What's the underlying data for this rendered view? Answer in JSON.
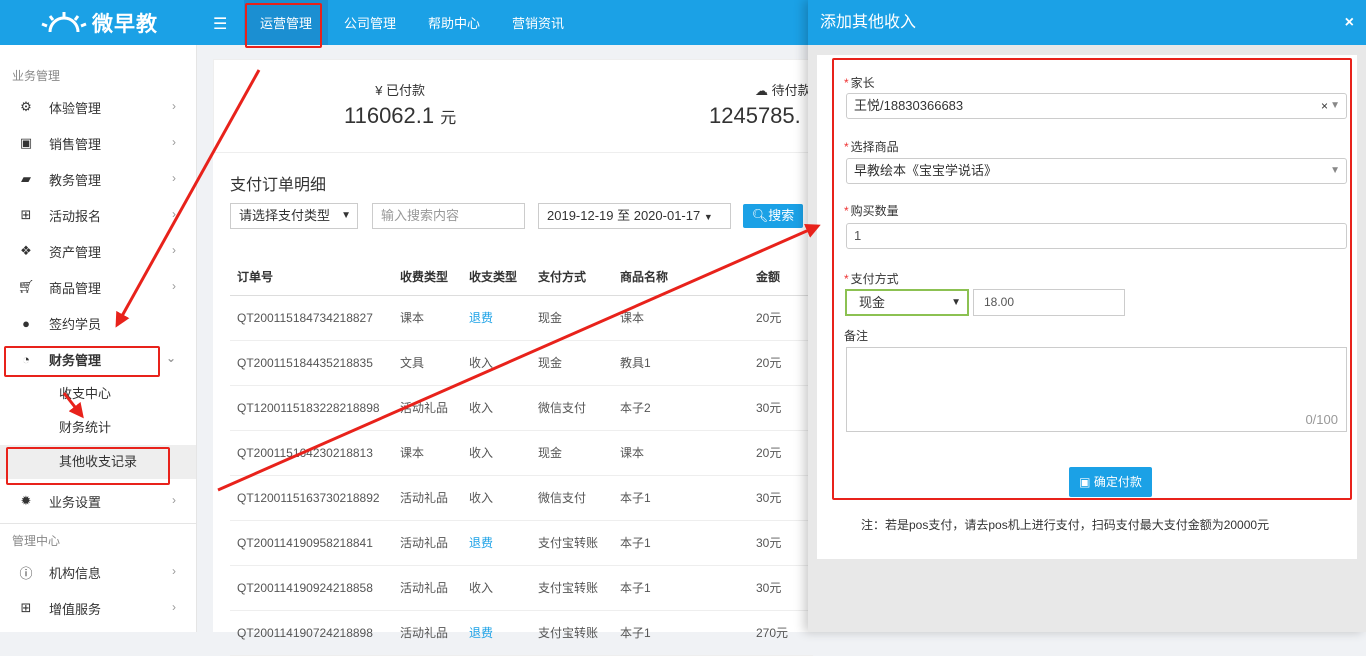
{
  "app": {
    "logo_text": "微早教"
  },
  "nav": {
    "items": [
      "运营管理",
      "公司管理",
      "帮助中心",
      "营销资讯"
    ]
  },
  "sidebar": {
    "section1": "业务管理",
    "items": [
      {
        "label": "体验管理",
        "icon": "gears-icon"
      },
      {
        "label": "销售管理",
        "icon": "money-icon"
      },
      {
        "label": "教务管理",
        "icon": "book-icon"
      },
      {
        "label": "活动报名",
        "icon": "table-icon"
      },
      {
        "label": "资产管理",
        "icon": "cubes-icon"
      },
      {
        "label": "商品管理",
        "icon": "cart-icon"
      },
      {
        "label": "签约学员",
        "icon": "user-icon"
      },
      {
        "label": "财务管理",
        "icon": "dashboard-icon"
      }
    ],
    "sub_items": [
      "收支中心",
      "财务统计",
      "其他收支记录"
    ],
    "settings": "业务设置",
    "section2": "管理中心",
    "items2": [
      {
        "label": "机构信息",
        "icon": "info-icon"
      },
      {
        "label": "增值服务",
        "icon": "plus-square-icon"
      }
    ]
  },
  "stats": {
    "paid_label": "¥ 已付款",
    "paid_value": "116062.1",
    "paid_unit": "元",
    "pending_label": "待付款",
    "pending_value": "1245785."
  },
  "panel": {
    "title": "支付订单明细",
    "pay_type_placeholder": "请选择支付类型",
    "search_placeholder": "输入搜索内容",
    "date_range": "2019-12-19 至 2020-01-17",
    "search_button": "搜索"
  },
  "table": {
    "headers": [
      "订单号",
      "收费类型",
      "收支类型",
      "支付方式",
      "商品名称",
      "金额"
    ],
    "rows": [
      [
        "QT200115184734218827",
        "课本",
        "退费",
        "现金",
        "课本",
        "20元"
      ],
      [
        "QT200115184435218835",
        "文具",
        "收入",
        "现金",
        "教具1",
        "20元"
      ],
      [
        "QT1200115183228218898",
        "活动礼品",
        "收入",
        "微信支付",
        "本子2",
        "30元"
      ],
      [
        "QT200115164230218813",
        "课本",
        "收入",
        "现金",
        "课本",
        "20元"
      ],
      [
        "QT1200115163730218892",
        "活动礼品",
        "收入",
        "微信支付",
        "本子1",
        "30元"
      ],
      [
        "QT200114190958218841",
        "活动礼品",
        "退费",
        "支付宝转账",
        "本子1",
        "30元"
      ],
      [
        "QT200114190924218858",
        "活动礼品",
        "收入",
        "支付宝转账",
        "本子1",
        "30元"
      ],
      [
        "QT200114190724218898",
        "活动礼品",
        "退费",
        "支付宝转账",
        "本子1",
        "270元"
      ]
    ]
  },
  "modal": {
    "title": "添加其他收入",
    "close": "×",
    "parent_label": "家长",
    "parent_value": "王悦/18830366683",
    "product_label": "选择商品",
    "product_value": "早教绘本《宝宝学说话》",
    "qty_label": "购买数量",
    "qty_value": "1",
    "pay_label": "支付方式",
    "pay_method": "现金",
    "pay_amount": "18.00",
    "remark_label": "备注",
    "remark_counter": "0/100",
    "confirm_button": "确定付款",
    "note": "注：若是pos支付，请去pos机上进行支付，扫码支付最大支付金额为20000元"
  },
  "colors": {
    "brand": "#1ba1e6",
    "highlight": "#e8221b",
    "link": "#1ba1e6"
  }
}
